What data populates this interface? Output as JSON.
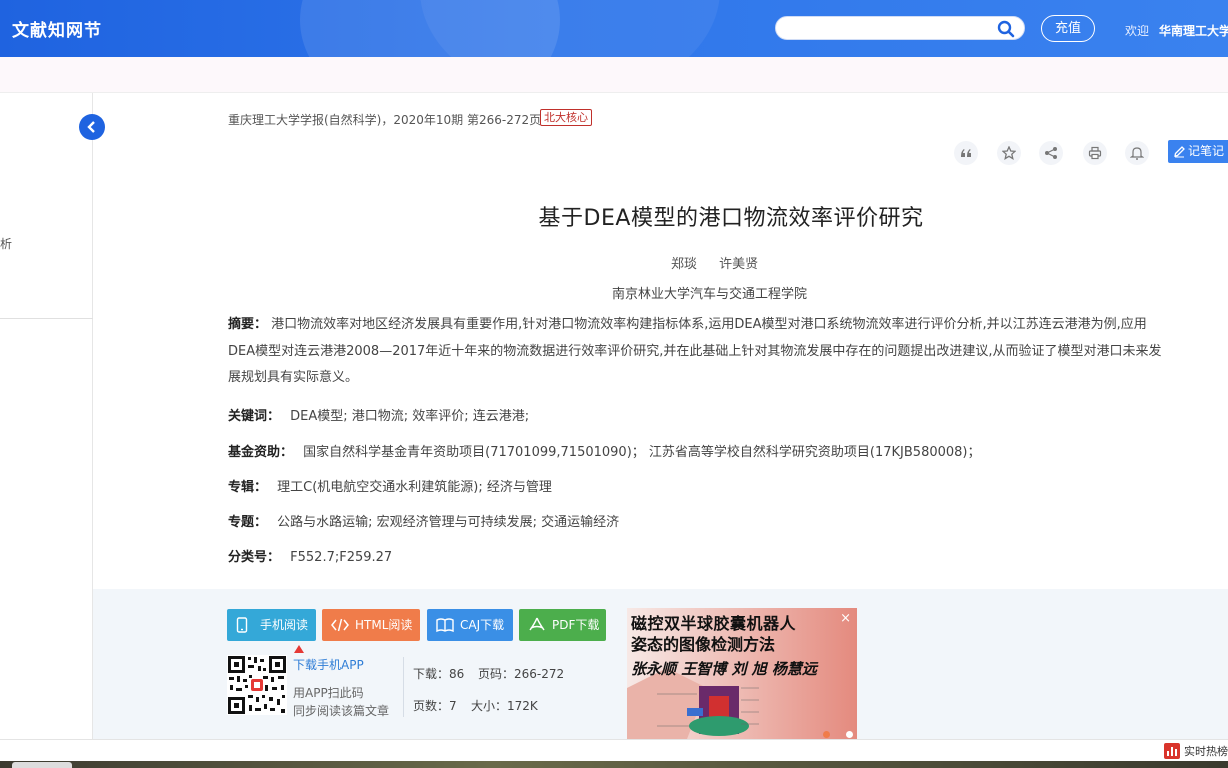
{
  "header": {
    "logo": "文献知网节",
    "search_placeholder": "",
    "recharge": "充值",
    "welcome": "欢迎",
    "username": "华南理工大学"
  },
  "left": {
    "partial_text": "析"
  },
  "article": {
    "source": "重庆理工大学学报(自然科学)，2020年10期   第266-272页",
    "badge": "北大核心",
    "title": "基于DEA模型的港口物流效率评价研究",
    "authors": [
      "郑琰",
      "许美贤"
    ],
    "affiliation": "南京林业大学汽车与交通工程学院",
    "abstract_label": "摘要：",
    "abstract_lines": [
      "港口物流效率对地区经济发展具有重要作用,针对港口物流效率构建指标体系,运用DEA模型对港口系统物流效率进行评价分析,并以江苏连云港港为例,应用",
      "DEA模型对连云港港2008—2017年近十年来的物流数据进行效率评价研究,并在此基础上针对其物流发展中存在的问题提出改进建议,从而验证了模型对港口未来发",
      "展规划具有实际意义。"
    ],
    "keywords_label": "关键词：",
    "keywords": "DEA模型;  港口物流;  效率评价;  连云港港;",
    "fund_label": "基金资助：",
    "fund": "国家自然科学基金青年资助项目(71701099,71501090)；  江苏省高等学校自然科学研究资助项目(17KJB580008)；",
    "series_label": "专辑：",
    "series": "理工C(机电航空交通水利建筑能源); 经济与管理",
    "topic_label": "专题：",
    "topic": "公路与水路运输; 宏观经济管理与可持续发展; 交通运输经济",
    "class_label": "分类号：",
    "class": "F552.7;F259.27"
  },
  "tools": {
    "note": "记笔记"
  },
  "actions": {
    "phone": "手机阅读",
    "html": "HTML阅读",
    "caj": "CAJ下载",
    "pdf": "PDF下载"
  },
  "app": {
    "link": "下载手机APP",
    "note1": "用APP扫此码",
    "note2": "同步阅读该篇文章"
  },
  "stats": {
    "downloads": "下载：86",
    "pages_range": "页码：266-272",
    "page_count": "页数：7",
    "size": "大小：172K"
  },
  "ad": {
    "line1": "磁控双半球胶囊机器人",
    "line2": "姿态的图像检测方法",
    "line3": "张永顺  王智博  刘  旭  杨慧远",
    "close": "×"
  },
  "footer": {
    "hot": "实时热榜"
  },
  "colors": {
    "header_blue": "#1f63e0",
    "badge_red": "#c0302b",
    "phone_btn": "#34a8d8",
    "html_btn": "#f07c4a",
    "caj_btn": "#3a8fe6",
    "pdf_btn": "#4cae4c"
  }
}
